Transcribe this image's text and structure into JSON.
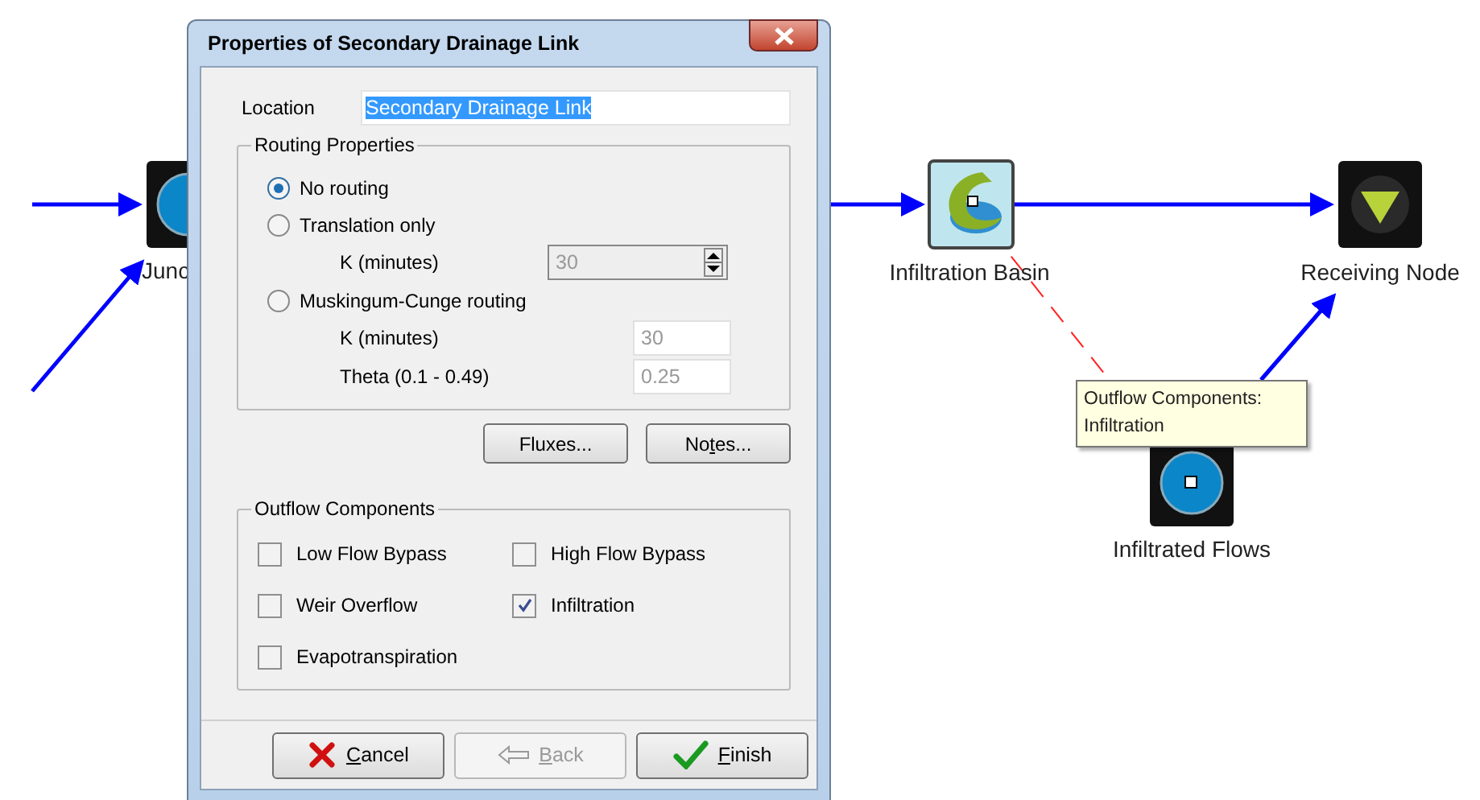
{
  "canvas": {
    "nodes": [
      {
        "kind": "junction",
        "label": "Junc"
      },
      {
        "kind": "basin",
        "label": "Infiltration Basin"
      },
      {
        "kind": "outfall",
        "label": "Receiving Node"
      },
      {
        "kind": "flows",
        "label": "Infiltrated Flows"
      }
    ],
    "tooltip": {
      "lines": [
        "Outflow Components:",
        "Infiltration"
      ]
    }
  },
  "dialog": {
    "title": "Properties of Secondary Drainage Link",
    "location": {
      "label": "Location",
      "value": "Secondary Drainage Link",
      "selected": true
    },
    "routing": {
      "title": "Routing Properties",
      "options": [
        {
          "label": "No routing",
          "selected": true
        },
        {
          "label": "Translation only",
          "selected": false,
          "fields": [
            {
              "kind": "spin",
              "label": "K (minutes)",
              "value": "30",
              "disabled": true
            }
          ]
        },
        {
          "label": "Muskingum-Cunge routing",
          "selected": false,
          "fields": [
            {
              "kind": "text",
              "label": "K (minutes)",
              "value": "30",
              "disabled": true
            },
            {
              "kind": "text",
              "label": "Theta (0.1 - 0.49)",
              "value": "0.25",
              "disabled": true
            }
          ]
        }
      ]
    },
    "side_buttons": [
      {
        "before": "Fluxes..."
      },
      {
        "before": "No",
        "key": "t",
        "after": "es..."
      }
    ],
    "outflow": {
      "title": "Outflow Components",
      "items": [
        {
          "label": "Low Flow Bypass",
          "checked": false
        },
        {
          "label": "High Flow Bypass",
          "checked": false
        },
        {
          "label": "Weir Overflow",
          "checked": false
        },
        {
          "label": "Infiltration",
          "checked": true
        },
        {
          "label": "Evapotranspiration",
          "checked": false
        }
      ]
    },
    "buttons": [
      {
        "kind": "cancel",
        "key": "C",
        "after": "ancel",
        "disabled": false
      },
      {
        "kind": "back",
        "key": "B",
        "after": "ack",
        "disabled": true
      },
      {
        "kind": "finish",
        "key": "F",
        "after": "inish",
        "disabled": false
      }
    ]
  }
}
